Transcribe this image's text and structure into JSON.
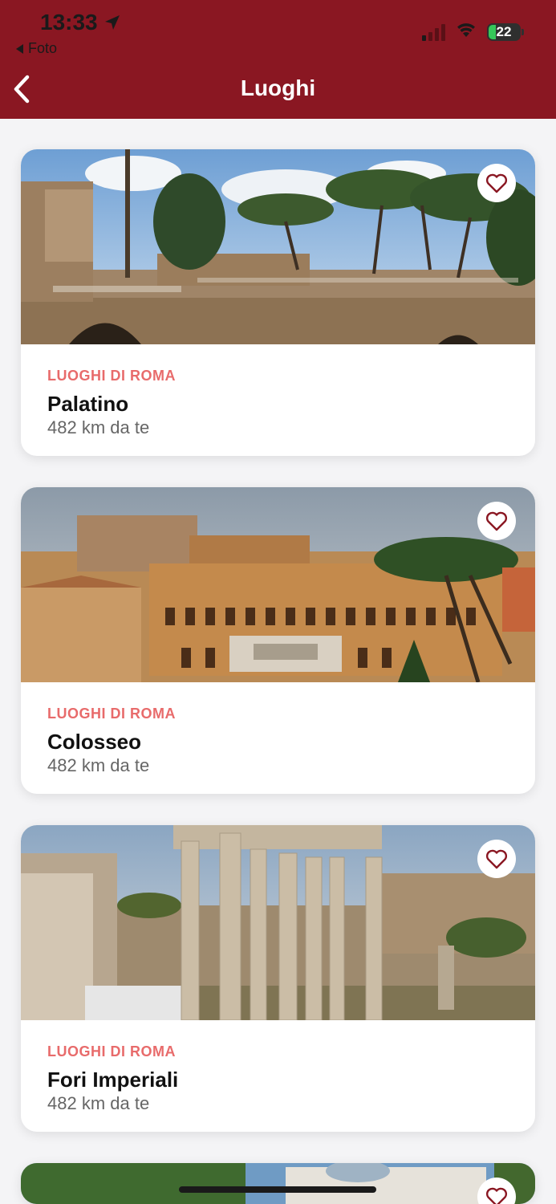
{
  "status_bar": {
    "time": "13:33",
    "back_app": "Foto",
    "battery": "22"
  },
  "nav": {
    "title": "Luoghi"
  },
  "colors": {
    "header": "#8a1722",
    "category": "#e86b6b"
  },
  "places": [
    {
      "category": "LUOGHI DI ROMA",
      "name": "Palatino",
      "distance": "482 km da te"
    },
    {
      "category": "LUOGHI DI ROMA",
      "name": "Colosseo",
      "distance": "482 km da te"
    },
    {
      "category": "LUOGHI DI ROMA",
      "name": "Fori Imperiali",
      "distance": "482 km da te"
    }
  ]
}
